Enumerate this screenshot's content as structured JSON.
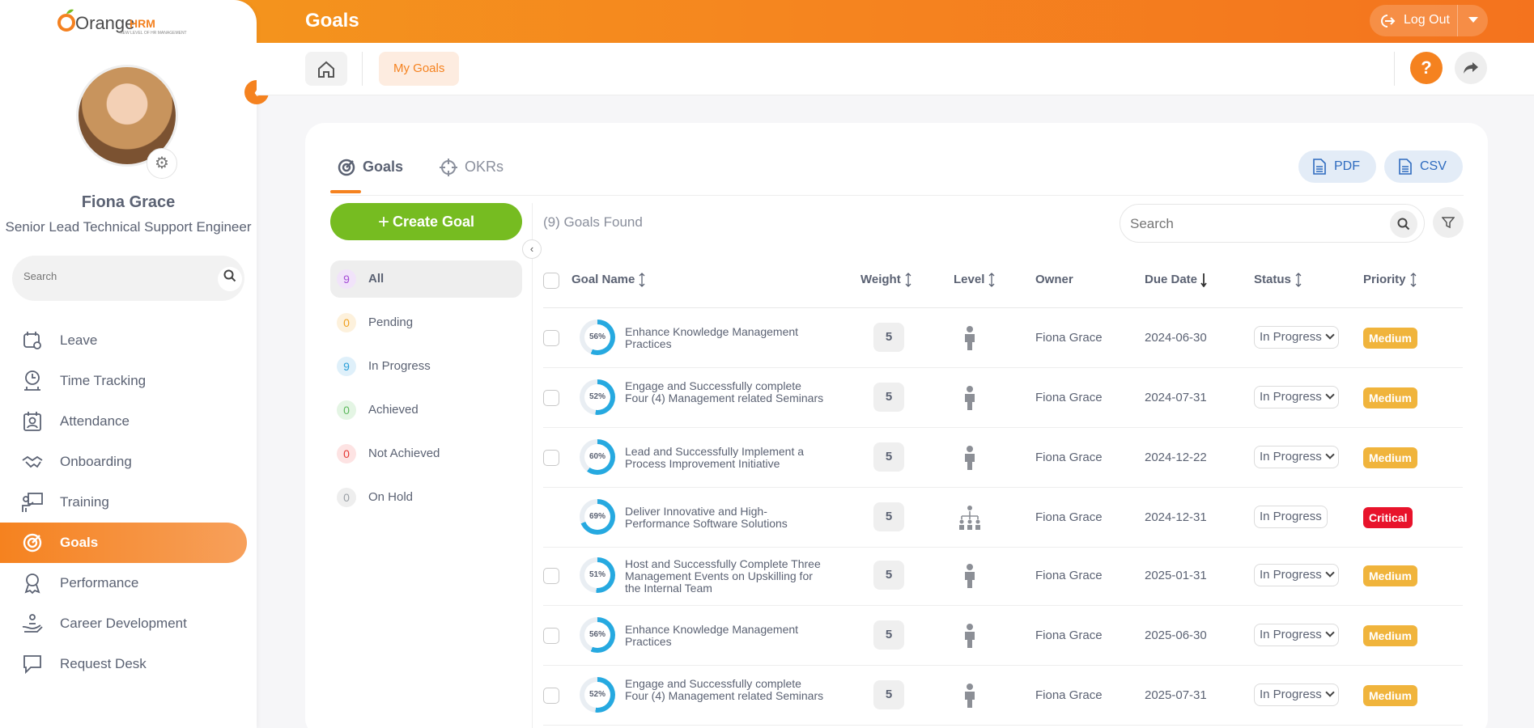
{
  "app": {
    "logo_main": "Orange",
    "logo_brand": "HRM",
    "logo_tagline": "NEW LEVEL OF HR MANAGEMENT"
  },
  "topbar": {
    "title": "Goals",
    "logout_label": "Log Out"
  },
  "sidebar": {
    "user_name": "Fiona Grace",
    "user_role": "Senior Lead Technical Support Engineer",
    "search_placeholder": "Search",
    "items": [
      {
        "label": "Leave",
        "icon": "leave-icon",
        "active": false
      },
      {
        "label": "Time Tracking",
        "icon": "time-tracking-icon",
        "active": false
      },
      {
        "label": "Attendance",
        "icon": "attendance-icon",
        "active": false
      },
      {
        "label": "Onboarding",
        "icon": "onboarding-icon",
        "active": false
      },
      {
        "label": "Training",
        "icon": "training-icon",
        "active": false
      },
      {
        "label": "Goals",
        "icon": "goals-icon",
        "active": true
      },
      {
        "label": "Performance",
        "icon": "performance-icon",
        "active": false
      },
      {
        "label": "Career Development",
        "icon": "career-development-icon",
        "active": false
      },
      {
        "label": "Request Desk",
        "icon": "request-desk-icon",
        "active": false
      }
    ]
  },
  "subheader": {
    "breadcrumb_label": "My Goals"
  },
  "tabs": [
    {
      "label": "Goals"
    },
    {
      "label": "OKRs"
    }
  ],
  "export": {
    "pdf_label": "PDF",
    "csv_label": "CSV"
  },
  "actions": {
    "create_label": "Create Goal"
  },
  "goals_found": "(9) Goals Found",
  "search": {
    "placeholder": "Search"
  },
  "filters": [
    {
      "count": "9",
      "label": "All",
      "color": "#a44bd6",
      "bg": "#f1e3fa"
    },
    {
      "count": "0",
      "label": "Pending",
      "color": "#f0a020",
      "bg": "#fdf1dc"
    },
    {
      "count": "9",
      "label": "In Progress",
      "color": "#2b9fd8",
      "bg": "#dff0fa"
    },
    {
      "count": "0",
      "label": "Achieved",
      "color": "#5cb85c",
      "bg": "#e4f5e4"
    },
    {
      "count": "0",
      "label": "Not Achieved",
      "color": "#e53935",
      "bg": "#fde3e3"
    },
    {
      "count": "0",
      "label": "On Hold",
      "color": "#9aa0a6",
      "bg": "#eeeeee"
    }
  ],
  "columns": {
    "goal_name": "Goal Name",
    "weight": "Weight",
    "level": "Level",
    "owner": "Owner",
    "due_date": "Due Date",
    "status": "Status",
    "priority": "Priority"
  },
  "colors": {
    "accent": "#f5821f",
    "ring": "#26a9e0",
    "medium": "#f0b43c",
    "critical": "#e8132b",
    "create": "#76bc21"
  },
  "rows": [
    {
      "progress": 56,
      "progress_label": "56%",
      "name": "Enhance Knowledge Management Practices",
      "weight": "5",
      "level": "individual",
      "owner": "Fiona Grace",
      "due": "2024-06-30",
      "status": "In Progress",
      "editable": true,
      "priority": "Medium"
    },
    {
      "progress": 52,
      "progress_label": "52%",
      "name": "Engage and Successfully complete Four (4) Management related Seminars",
      "weight": "5",
      "level": "individual",
      "owner": "Fiona Grace",
      "due": "2024-07-31",
      "status": "In Progress",
      "editable": true,
      "priority": "Medium"
    },
    {
      "progress": 60,
      "progress_label": "60%",
      "name": "Lead and Successfully Implement a Process Improvement Initiative",
      "weight": "5",
      "level": "individual",
      "owner": "Fiona Grace",
      "due": "2024-12-22",
      "status": "In Progress",
      "editable": true,
      "priority": "Medium"
    },
    {
      "progress": 69,
      "progress_label": "69%",
      "name": "Deliver Innovative and High-Performance Software Solutions",
      "weight": "5",
      "level": "organization",
      "owner": "Fiona Grace",
      "due": "2024-12-31",
      "status": "In Progress",
      "editable": false,
      "priority": "Critical"
    },
    {
      "progress": 51,
      "progress_label": "51%",
      "name": "Host and Successfully Complete Three Management Events on Upskilling for the Internal Team",
      "weight": "5",
      "level": "individual",
      "owner": "Fiona Grace",
      "due": "2025-01-31",
      "status": "In Progress",
      "editable": true,
      "priority": "Medium"
    },
    {
      "progress": 56,
      "progress_label": "56%",
      "name": "Enhance Knowledge Management Practices",
      "weight": "5",
      "level": "individual",
      "owner": "Fiona Grace",
      "due": "2025-06-30",
      "status": "In Progress",
      "editable": true,
      "priority": "Medium"
    },
    {
      "progress": 52,
      "progress_label": "52%",
      "name": "Engage and Successfully complete Four (4) Management related Seminars",
      "weight": "5",
      "level": "individual",
      "owner": "Fiona Grace",
      "due": "2025-07-31",
      "status": "In Progress",
      "editable": true,
      "priority": "Medium"
    }
  ]
}
